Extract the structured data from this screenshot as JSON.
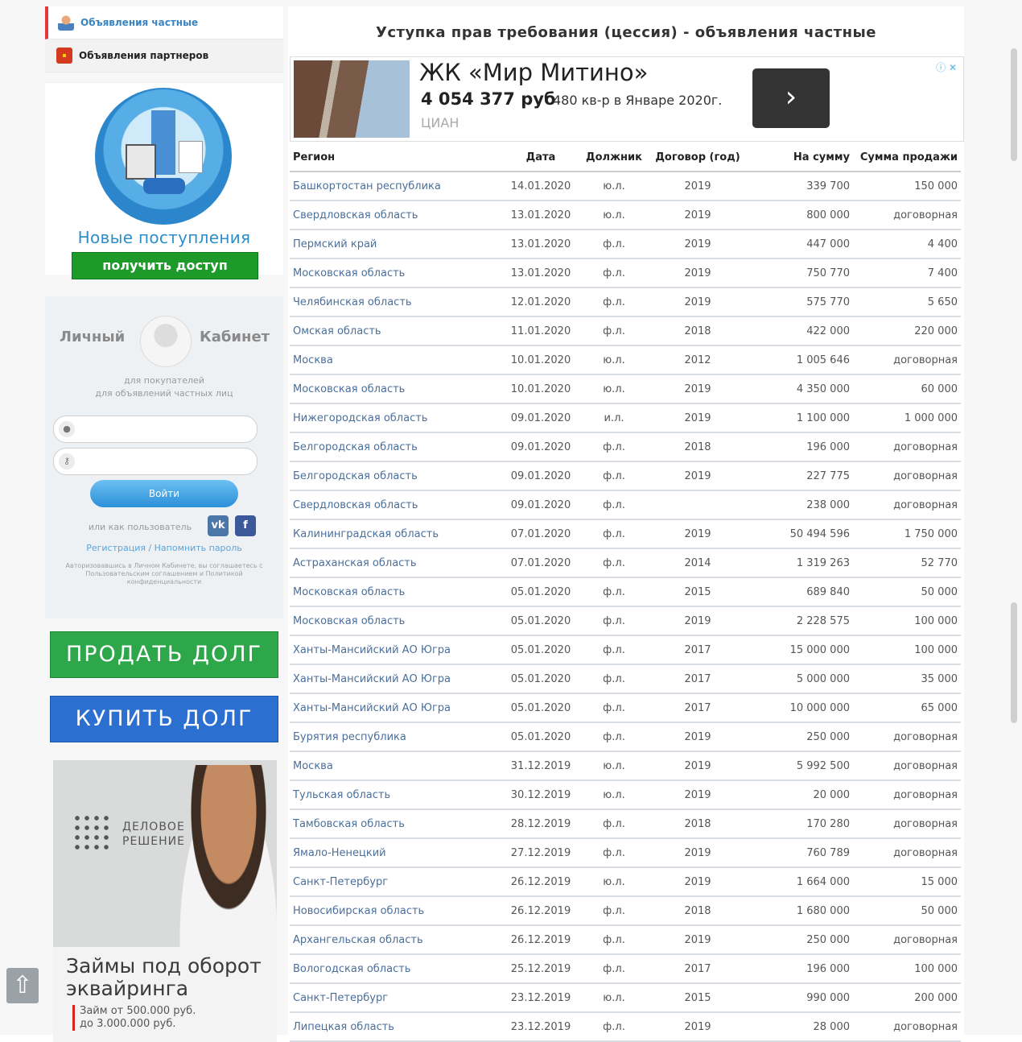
{
  "nav": {
    "private_label": "Объявления частные",
    "partners_label": "Объявления партнеров"
  },
  "promo": {
    "title": "Новые поступления",
    "button": "получить доступ"
  },
  "login": {
    "title_left": "Личный",
    "title_right": "Кабинет",
    "subtitle_1": "для покупателей",
    "subtitle_2": "для объявлений частных лиц",
    "login_button": "Войти",
    "social_text": "или как пользователь",
    "vk_label": "vk",
    "fb_label": "f",
    "links": "Регистрация / Напомнить пароль",
    "fine_print": "Авторизовавшись в Личном Кабинете, вы соглашаетесь с Пользовательским соглашением и Политикой конфиденциальности"
  },
  "actions": {
    "sell": "ПРОДАТЬ ДОЛГ",
    "buy": "КУПИТЬ ДОЛГ"
  },
  "side_ad": {
    "brand_1": "ДЕЛОВОЕ",
    "brand_2": "РЕШЕНИЕ",
    "headline_1": "Займы под оборот",
    "headline_2": "эквайринга",
    "sub_1": "Займ от 500.000 руб.",
    "sub_2": "до 3.000.000 руб."
  },
  "main": {
    "title": "Уступка прав требования (цессия) - объявления частные"
  },
  "ad_banner": {
    "name": "ЖК «Мир Митино»",
    "price": "4 054 377 руб",
    "desc": "480 кв-р в Январе 2020г.",
    "source": "ЦИАН",
    "info": "ⓘ ✕",
    "arrow": "›"
  },
  "table": {
    "headers": {
      "region": "Регион",
      "date": "Дата",
      "debtor": "Должник",
      "year": "Договор (год)",
      "sum": "На сумму",
      "sale": "Сумма продажи"
    },
    "rows": [
      {
        "region": "Башкортостан республика",
        "date": "14.01.2020",
        "debtor": "ю.л.",
        "year": "2019",
        "sum": "339 700",
        "sale": "150 000"
      },
      {
        "region": "Свердловская область",
        "date": "13.01.2020",
        "debtor": "ю.л.",
        "year": "2019",
        "sum": "800 000",
        "sale": "договорная"
      },
      {
        "region": "Пермский край",
        "date": "13.01.2020",
        "debtor": "ф.л.",
        "year": "2019",
        "sum": "447 000",
        "sale": "4 400"
      },
      {
        "region": "Московская область",
        "date": "13.01.2020",
        "debtor": "ф.л.",
        "year": "2019",
        "sum": "750 770",
        "sale": "7 400"
      },
      {
        "region": "Челябинская область",
        "date": "12.01.2020",
        "debtor": "ф.л.",
        "year": "2019",
        "sum": "575 770",
        "sale": "5 650"
      },
      {
        "region": "Омская область",
        "date": "11.01.2020",
        "debtor": "ф.л.",
        "year": "2018",
        "sum": "422 000",
        "sale": "220 000"
      },
      {
        "region": "Москва",
        "date": "10.01.2020",
        "debtor": "ю.л.",
        "year": "2012",
        "sum": "1 005 646",
        "sale": "договорная"
      },
      {
        "region": "Московская область",
        "date": "10.01.2020",
        "debtor": "ю.л.",
        "year": "2019",
        "sum": "4 350 000",
        "sale": "60 000"
      },
      {
        "region": "Нижегородская область",
        "date": "09.01.2020",
        "debtor": "и.л.",
        "year": "2019",
        "sum": "1 100 000",
        "sale": "1 000 000"
      },
      {
        "region": "Белгородская область",
        "date": "09.01.2020",
        "debtor": "ф.л.",
        "year": "2018",
        "sum": "196 000",
        "sale": "договорная"
      },
      {
        "region": "Белгородская область",
        "date": "09.01.2020",
        "debtor": "ф.л.",
        "year": "2019",
        "sum": "227 775",
        "sale": "договорная"
      },
      {
        "region": "Свердловская область",
        "date": "09.01.2020",
        "debtor": "ф.л.",
        "year": "",
        "sum": "238 000",
        "sale": "договорная"
      },
      {
        "region": "Калининградская область",
        "date": "07.01.2020",
        "debtor": "ф.л.",
        "year": "2019",
        "sum": "50 494 596",
        "sale": "1 750 000"
      },
      {
        "region": "Астраханская область",
        "date": "07.01.2020",
        "debtor": "ф.л.",
        "year": "2014",
        "sum": "1 319 263",
        "sale": "52 770"
      },
      {
        "region": "Московская область",
        "date": "05.01.2020",
        "debtor": "ф.л.",
        "year": "2015",
        "sum": "689 840",
        "sale": "50 000"
      },
      {
        "region": "Московская область",
        "date": "05.01.2020",
        "debtor": "ф.л.",
        "year": "2019",
        "sum": "2 228 575",
        "sale": "100 000"
      },
      {
        "region": "Ханты-Мансийский АО Югра",
        "date": "05.01.2020",
        "debtor": "ф.л.",
        "year": "2017",
        "sum": "15 000 000",
        "sale": "100 000"
      },
      {
        "region": "Ханты-Мансийский АО Югра",
        "date": "05.01.2020",
        "debtor": "ф.л.",
        "year": "2017",
        "sum": "5 000 000",
        "sale": "35 000"
      },
      {
        "region": "Ханты-Мансийский АО Югра",
        "date": "05.01.2020",
        "debtor": "ф.л.",
        "year": "2017",
        "sum": "10 000 000",
        "sale": "65 000"
      },
      {
        "region": "Бурятия республика",
        "date": "05.01.2020",
        "debtor": "ф.л.",
        "year": "2019",
        "sum": "250 000",
        "sale": "договорная"
      },
      {
        "region": "Москва",
        "date": "31.12.2019",
        "debtor": "ю.л.",
        "year": "2019",
        "sum": "5 992 500",
        "sale": "договорная"
      },
      {
        "region": "Тульская область",
        "date": "30.12.2019",
        "debtor": "ю.л.",
        "year": "2019",
        "sum": "20 000",
        "sale": "договорная"
      },
      {
        "region": "Тамбовская область",
        "date": "28.12.2019",
        "debtor": "ф.л.",
        "year": "2018",
        "sum": "170 280",
        "sale": "договорная"
      },
      {
        "region": "Ямало-Ненецкий",
        "date": "27.12.2019",
        "debtor": "ф.л.",
        "year": "2019",
        "sum": "760 789",
        "sale": "договорная"
      },
      {
        "region": "Санкт-Петербург",
        "date": "26.12.2019",
        "debtor": "ю.л.",
        "year": "2019",
        "sum": "1 664 000",
        "sale": "15 000"
      },
      {
        "region": "Новосибирская область",
        "date": "26.12.2019",
        "debtor": "ф.л.",
        "year": "2018",
        "sum": "1 680 000",
        "sale": "50 000"
      },
      {
        "region": "Архангельская область",
        "date": "26.12.2019",
        "debtor": "ф.л.",
        "year": "2019",
        "sum": "250 000",
        "sale": "договорная"
      },
      {
        "region": "Вологодская область",
        "date": "25.12.2019",
        "debtor": "ф.л.",
        "year": "2017",
        "sum": "196 000",
        "sale": "100 000"
      },
      {
        "region": "Санкт-Петербург",
        "date": "23.12.2019",
        "debtor": "ю.л.",
        "year": "2015",
        "sum": "990 000",
        "sale": "200 000"
      },
      {
        "region": "Липецкая область",
        "date": "23.12.2019",
        "debtor": "ф.л.",
        "year": "2019",
        "sum": "28 000",
        "sale": "договорная"
      }
    ]
  },
  "icons": {
    "person": "person-icon",
    "briefcase": "briefcase-icon",
    "user_field": "user-icon",
    "key_field": "key-icon",
    "scroll_up": "arrow-up-icon"
  },
  "colors": {
    "green_button": "#1e9a2a",
    "sell": "#2ea64a",
    "buy": "#2b6fd0",
    "link": "#4a6f9b"
  }
}
